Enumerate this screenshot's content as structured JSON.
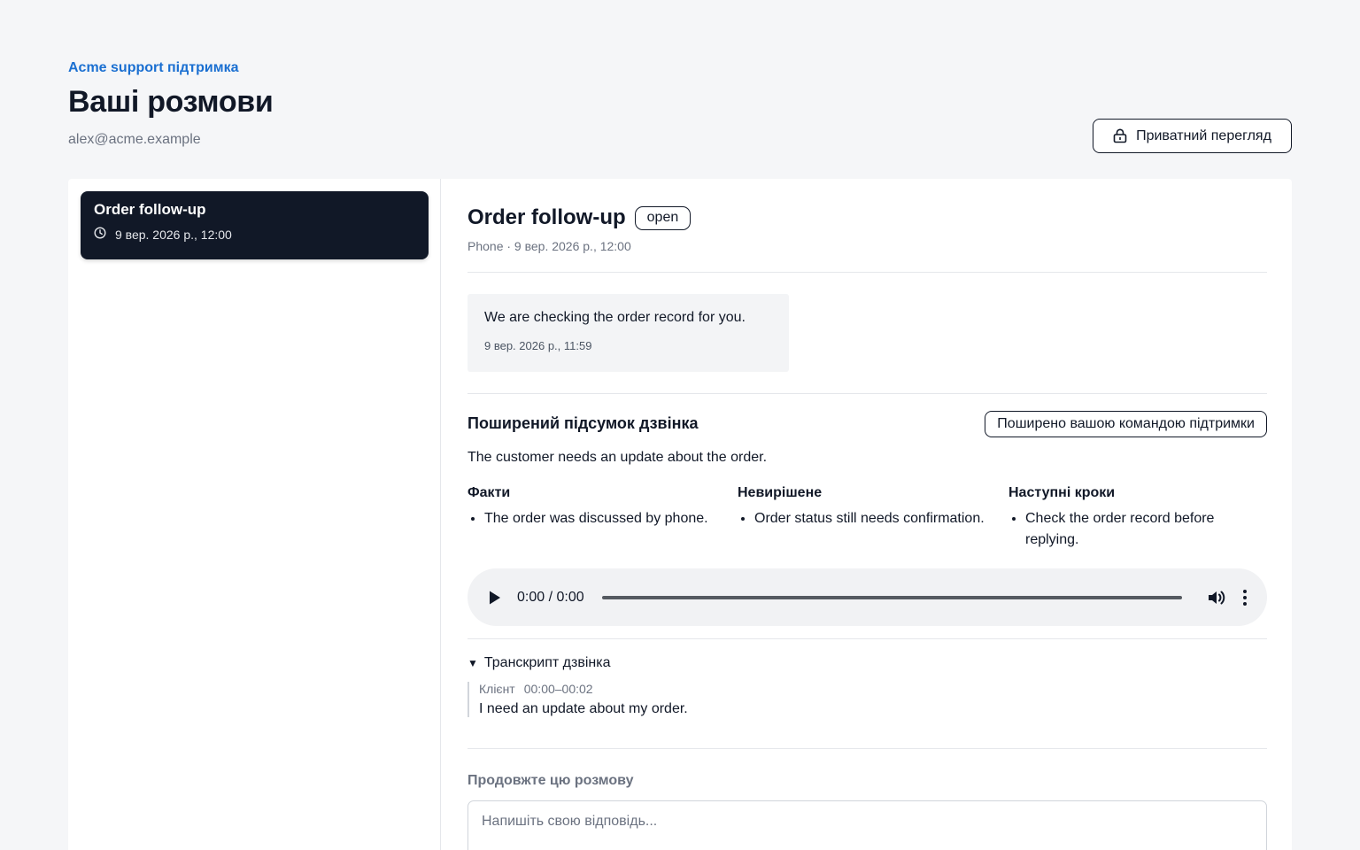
{
  "header": {
    "brand": "Acme support підтримка",
    "title": "Ваші розмови",
    "email": "alex@acme.example",
    "private_view_label": "Приватний перегляд"
  },
  "sidebar": {
    "conversations": [
      {
        "title": "Order follow-up",
        "time": "9 вер. 2026 р., 12:00",
        "active": true
      }
    ]
  },
  "detail": {
    "title": "Order follow-up",
    "status": "open",
    "meta": "Phone · 9 вер. 2026 р., 12:00",
    "message": {
      "text": "We are checking the order record for you.",
      "time": "9 вер. 2026 р., 11:59"
    },
    "summary": {
      "title": "Поширений підсумок дзвінка",
      "shared_badge": "Поширено вашою командою підтримки",
      "text": "The customer needs an update about the order.",
      "columns": [
        {
          "title": "Факти",
          "items": [
            "The order was discussed by phone."
          ]
        },
        {
          "title": "Невирішене",
          "items": [
            "Order status still needs confirmation."
          ]
        },
        {
          "title": "Наступні кроки",
          "items": [
            "Check the order record before replying."
          ]
        }
      ]
    },
    "audio": {
      "time": "0:00 / 0:00",
      "icons": [
        "play-icon",
        "volume-icon",
        "more-vertical-icon"
      ]
    },
    "transcript": {
      "toggle_label": "Транскрипт дзвінка",
      "expanded": true,
      "entries": [
        {
          "speaker": "Клієнт",
          "range": "00:00–00:02",
          "text": "I need an update about my order."
        }
      ]
    },
    "reply": {
      "label": "Продовжте цю розмову",
      "placeholder": "Напишіть свою відповідь..."
    }
  },
  "colors": {
    "accent": "#1a6fd1",
    "dark": "#111827",
    "background": "#f5f6f8"
  }
}
